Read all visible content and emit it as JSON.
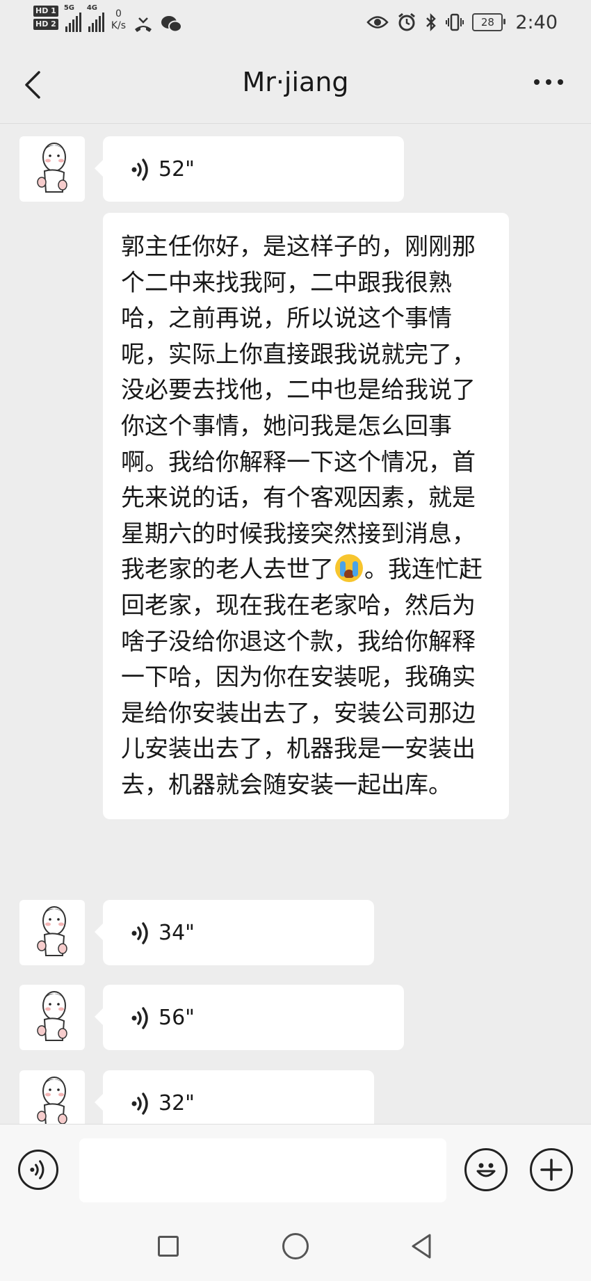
{
  "status_bar": {
    "hd1": "HD 1",
    "hd2": "HD 2",
    "network1": "5G",
    "network2": "4G",
    "speed_value": "0",
    "speed_unit": "K/s",
    "battery": "28",
    "time": "2:40"
  },
  "header": {
    "title": "Mr·jiang"
  },
  "messages": [
    {
      "type": "voice",
      "duration": "52\""
    },
    {
      "type": "text",
      "before_emoji": "郭主任你好，是这样子的，刚刚那个二中来找我阿，二中跟我很熟哈，之前再说，所以说这个事情呢，实际上你直接跟我说就完了，没必要去找他，二中也是给我说了你这个事情，她问我是怎么回事啊。我给你解释一下这个情况，首先来说的话，有个客观因素，就是星期六的时候我接突然接到消息，我老家的老人去世了",
      "emoji": "loudly-crying-face",
      "after_emoji": "。我连忙赶回老家，现在我在老家哈，然后为啥子没给你退这个款，我给你解释一下哈，因为你在安装呢，我确实是给你安装出去了，安装公司那边儿安装出去了，机器我是一安装出去，机器就会随安装一起出库。"
    },
    {
      "type": "voice",
      "duration": "34\""
    },
    {
      "type": "voice",
      "duration": "56\""
    },
    {
      "type": "voice",
      "duration": "32\""
    }
  ],
  "input_bar": {
    "voice_icon": "voice-input-icon",
    "emoji_icon": "emoji-icon",
    "plus_icon": "add-icon",
    "message_value": ""
  },
  "nav_bar": {
    "recent_icon": "square-icon",
    "home_icon": "circle-icon",
    "back_icon": "triangle-back-icon"
  }
}
